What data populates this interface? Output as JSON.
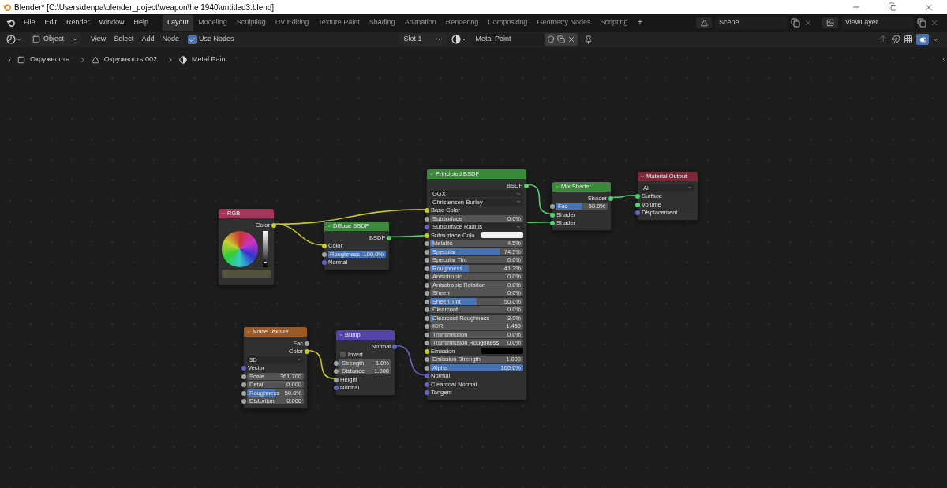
{
  "window": {
    "title": "Blender* [C:\\Users\\denpa\\blender_poject\\weapon\\he 1940\\untitled3.blend]"
  },
  "menu": [
    "File",
    "Edit",
    "Render",
    "Window",
    "Help"
  ],
  "workspaces": [
    {
      "label": "Layout",
      "selected": true
    },
    {
      "label": "Modeling",
      "selected": false
    },
    {
      "label": "Sculpting",
      "selected": false
    },
    {
      "label": "UV Editing",
      "selected": false
    },
    {
      "label": "Texture Paint",
      "selected": false
    },
    {
      "label": "Shading",
      "selected": false
    },
    {
      "label": "Animation",
      "selected": false
    },
    {
      "label": "Rendering",
      "selected": false
    },
    {
      "label": "Compositing",
      "selected": false
    },
    {
      "label": "Geometry Nodes",
      "selected": false
    },
    {
      "label": "Scripting",
      "selected": false
    }
  ],
  "add_workspace": "+",
  "scene": "Scene",
  "view_layer": "ViewLayer",
  "header": {
    "mode": "Object",
    "menus": [
      "View",
      "Select",
      "Add",
      "Node"
    ],
    "use_nodes": {
      "label": "Use Nodes",
      "checked": true
    },
    "slot": "Slot 1",
    "material": "Metal Paint"
  },
  "breadcrumbs": [
    "Окружность",
    "Окружность.002",
    "Metal Paint"
  ],
  "nodes": [
    {
      "title": "RGB",
      "color": "#a3365a",
      "rows": [
        {
          "kind": "output",
          "label": "Color",
          "socket": {
            "color": "#c7c729"
          }
        },
        {
          "kind": "colorwheel",
          "level": 0.1
        }
      ]
    },
    {
      "title": "Diffuse BSDF",
      "color": "#3b8a3b",
      "rows": [
        {
          "kind": "output",
          "label": "BSDF",
          "socket": {
            "color": "#4fd16b"
          }
        },
        {
          "kind": "input",
          "label": "Color",
          "socket": {
            "color": "#c7c729"
          }
        },
        {
          "kind": "slider",
          "label": "Roughness",
          "value": "100.0%",
          "level": 1,
          "socket": {
            "color": "#a1a1a1"
          }
        },
        {
          "kind": "input",
          "label": "Normal",
          "socket": {
            "color": "#6363c7"
          }
        }
      ]
    },
    {
      "title": "Principled BSDF",
      "color": "#3b8a3b",
      "rows": [
        {
          "kind": "output",
          "label": "BSDF",
          "socket": {
            "color": "#4fd16b"
          }
        },
        {
          "kind": "dropdown",
          "value": "GGX"
        },
        {
          "kind": "dropdown",
          "value": "Christensen-Burley"
        },
        {
          "kind": "input",
          "label": "Base Color",
          "socket": {
            "color": "#c7c729"
          }
        },
        {
          "kind": "slider",
          "label": "Subsurface",
          "value": "0.0%",
          "socket": {
            "color": "#a1a1a1"
          }
        },
        {
          "kind": "dropdown",
          "value": "Subsurface Radius",
          "socket": {
            "color": "#6363c7"
          }
        },
        {
          "kind": "color",
          "label": "Subsurface Colo",
          "swatch": {
            "color": "#f2f2f2"
          },
          "socket": {
            "color": "#c7c729"
          }
        },
        {
          "kind": "slider",
          "label": "Metallic",
          "value": "4.5%",
          "level": 0.045,
          "socket": {
            "color": "#a1a1a1"
          }
        },
        {
          "kind": "slider",
          "label": "Specular",
          "value": "74.5%",
          "level": 0.745,
          "socket": {
            "color": "#a1a1a1"
          }
        },
        {
          "kind": "slider",
          "label": "Specular Tint",
          "value": "0.0%",
          "socket": {
            "color": "#a1a1a1"
          }
        },
        {
          "kind": "slider",
          "label": "Roughness",
          "value": "41.3%",
          "level": 0.413,
          "socket": {
            "color": "#a1a1a1"
          }
        },
        {
          "kind": "slider",
          "label": "Anisotropic",
          "value": "0.0%",
          "socket": {
            "color": "#a1a1a1"
          }
        },
        {
          "kind": "slider",
          "label": "Anisotropic Rotation",
          "value": "0.0%",
          "socket": {
            "color": "#a1a1a1"
          }
        },
        {
          "kind": "slider",
          "label": "Sheen",
          "value": "0.0%",
          "socket": {
            "color": "#a1a1a1"
          }
        },
        {
          "kind": "slider",
          "label": "Sheen Tint",
          "value": "50.0%",
          "level": 0.5,
          "socket": {
            "color": "#a1a1a1"
          }
        },
        {
          "kind": "slider",
          "label": "Clearcoat",
          "value": "0.0%",
          "socket": {
            "color": "#a1a1a1"
          }
        },
        {
          "kind": "slider",
          "label": "Clearcoat Roughness",
          "value": "3.0%",
          "level": 0.03,
          "socket": {
            "color": "#a1a1a1"
          }
        },
        {
          "kind": "number",
          "label": "IOR",
          "value": "1.450",
          "socket": {
            "color": "#a1a1a1"
          }
        },
        {
          "kind": "slider",
          "label": "Transmission",
          "value": "0.0%",
          "socket": {
            "color": "#a1a1a1"
          }
        },
        {
          "kind": "slider",
          "label": "Transmission Roughness",
          "value": "0.0%",
          "socket": {
            "color": "#a1a1a1"
          }
        },
        {
          "kind": "color",
          "label": "Emission",
          "swatch": {
            "color": "#000000"
          },
          "socket": {
            "color": "#c7c729"
          }
        },
        {
          "kind": "number",
          "label": "Emission Strength",
          "value": "1.000",
          "socket": {
            "color": "#a1a1a1"
          }
        },
        {
          "kind": "slider",
          "label": "Alpha",
          "value": "100.0%",
          "level": 1,
          "socket": {
            "color": "#a1a1a1"
          }
        },
        {
          "kind": "input",
          "label": "Normal",
          "socket": {
            "color": "#6363c7"
          }
        },
        {
          "kind": "input",
          "label": "Clearcoat Normal",
          "socket": {
            "color": "#6363c7"
          }
        },
        {
          "kind": "input",
          "label": "Tangent",
          "socket": {
            "color": "#6363c7"
          }
        }
      ]
    },
    {
      "title": "Mix Shader",
      "color": "#3b8a3b",
      "rows": [
        {
          "kind": "output",
          "label": "Shader",
          "socket": {
            "color": "#4fd16b"
          }
        },
        {
          "kind": "slider",
          "label": "Fac",
          "value": "50.0%",
          "level": 0.5,
          "socket": {
            "color": "#a1a1a1"
          }
        },
        {
          "kind": "input",
          "label": "Shader",
          "socket": {
            "color": "#4fd16b"
          }
        },
        {
          "kind": "input",
          "label": "Shader",
          "socket": {
            "color": "#4fd16b"
          }
        }
      ]
    },
    {
      "title": "Material Output",
      "color": "#7a2a36",
      "rows": [
        {
          "kind": "dropdown",
          "value": "All"
        },
        {
          "kind": "input",
          "label": "Surface",
          "socket": {
            "color": "#4fd16b"
          }
        },
        {
          "kind": "input",
          "label": "Volume",
          "socket": {
            "color": "#4fd16b"
          }
        },
        {
          "kind": "input",
          "label": "Displacement",
          "socket": {
            "color": "#6363c7"
          }
        }
      ]
    },
    {
      "title": "Noise Texture",
      "color": "#9b5a26",
      "rows": [
        {
          "kind": "output",
          "label": "Fac",
          "socket": {
            "color": "#a1a1a1"
          }
        },
        {
          "kind": "output",
          "label": "Color",
          "socket": {
            "color": "#c7c729"
          }
        },
        {
          "kind": "dropdown",
          "value": "3D"
        },
        {
          "kind": "input",
          "label": "Vector",
          "socket": {
            "color": "#6363c7"
          }
        },
        {
          "kind": "number",
          "label": "Scale",
          "value": "361.700",
          "socket": {
            "color": "#a1a1a1"
          }
        },
        {
          "kind": "number",
          "label": "Detail",
          "value": "0.000",
          "socket": {
            "color": "#a1a1a1"
          }
        },
        {
          "kind": "slider",
          "label": "Roughness",
          "value": "50.0%",
          "level": 0.5,
          "socket": {
            "color": "#a1a1a1"
          }
        },
        {
          "kind": "number",
          "label": "Distortion",
          "value": "0.000",
          "socket": {
            "color": "#a1a1a1"
          }
        }
      ]
    },
    {
      "title": "Bump",
      "color": "#5443a8",
      "rows": [
        {
          "kind": "output",
          "label": "Normal",
          "socket": {
            "color": "#6363c7"
          }
        },
        {
          "kind": "checkbox",
          "label": "Invert",
          "checked": false
        },
        {
          "kind": "slider",
          "label": "Strength",
          "value": "1.0%",
          "level": 0.01,
          "socket": {
            "color": "#a1a1a1"
          }
        },
        {
          "kind": "number",
          "label": "Distance",
          "value": "1.000",
          "socket": {
            "color": "#a1a1a1"
          }
        },
        {
          "kind": "input",
          "label": "Height",
          "socket": {
            "color": "#a1a1a1"
          }
        },
        {
          "kind": "input",
          "label": "Normal",
          "socket": {
            "color": "#6363c7"
          }
        }
      ]
    }
  ]
}
